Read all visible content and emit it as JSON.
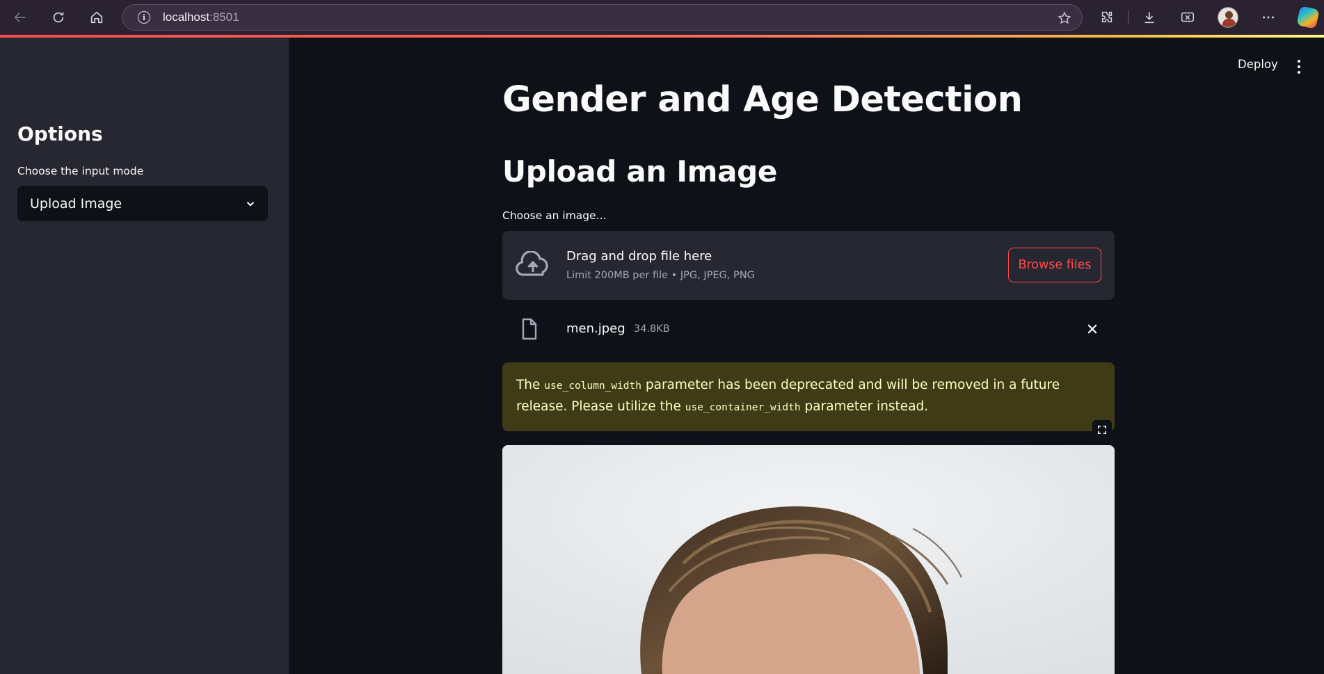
{
  "browser": {
    "url_host": "localhost",
    "url_port": ":8501",
    "icons": [
      "back-arrow-icon",
      "reload-icon",
      "home-icon",
      "info-icon",
      "star-icon",
      "extensions-icon",
      "download-icon",
      "screenshot-icon",
      "profile-avatar",
      "more-icon",
      "copilot-icon"
    ]
  },
  "sidebar": {
    "title": "Options",
    "input_mode_label": "Choose the input mode",
    "input_mode_value": "Upload Image"
  },
  "header": {
    "deploy_label": "Deploy"
  },
  "main": {
    "title": "Gender and Age Detection",
    "subtitle": "Upload an Image",
    "uploader": {
      "label": "Choose an image...",
      "drop_title": "Drag and drop file here",
      "drop_limit": "Limit 200MB per file • JPG, JPEG, PNG",
      "browse_label": "Browse files"
    },
    "uploaded_file": {
      "name": "men.jpeg",
      "size": "34.8KB"
    },
    "warning": {
      "t1": "The ",
      "code1": "use_column_width",
      "t2": " parameter has been deprecated and will be removed in a future release. Please utilize the ",
      "code2": "use_container_width",
      "t3": " parameter instead."
    }
  },
  "colors": {
    "accent": "#ff4b4b",
    "sidebar_bg": "#262730",
    "app_bg": "#0e1117",
    "warning_bg": "#3e3b16",
    "warning_text": "#ffffc2"
  }
}
